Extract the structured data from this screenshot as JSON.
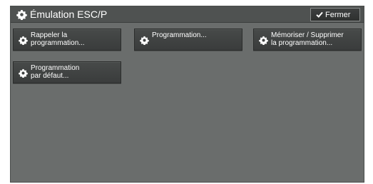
{
  "header": {
    "title": "Émulation ESC/P",
    "title_icon": "gear-icon",
    "close_label": "Fermer",
    "close_icon": "checkmark-icon"
  },
  "tiles": [
    {
      "label": "Rappeler la\nprogrammation...",
      "icon": "gear-icon"
    },
    {
      "label": "Programmation...",
      "icon": "gear-icon"
    },
    {
      "label": "Mémoriser / Supprimer\nla programmation...",
      "icon": "gear-icon"
    },
    {
      "label": "Programmation\npar défaut...",
      "icon": "gear-icon"
    }
  ],
  "colors": {
    "panel_bg": "#6a6d6c",
    "titlebar_bg": "#4f5251",
    "tile_bg": "#404342",
    "text": "#ffffff"
  }
}
